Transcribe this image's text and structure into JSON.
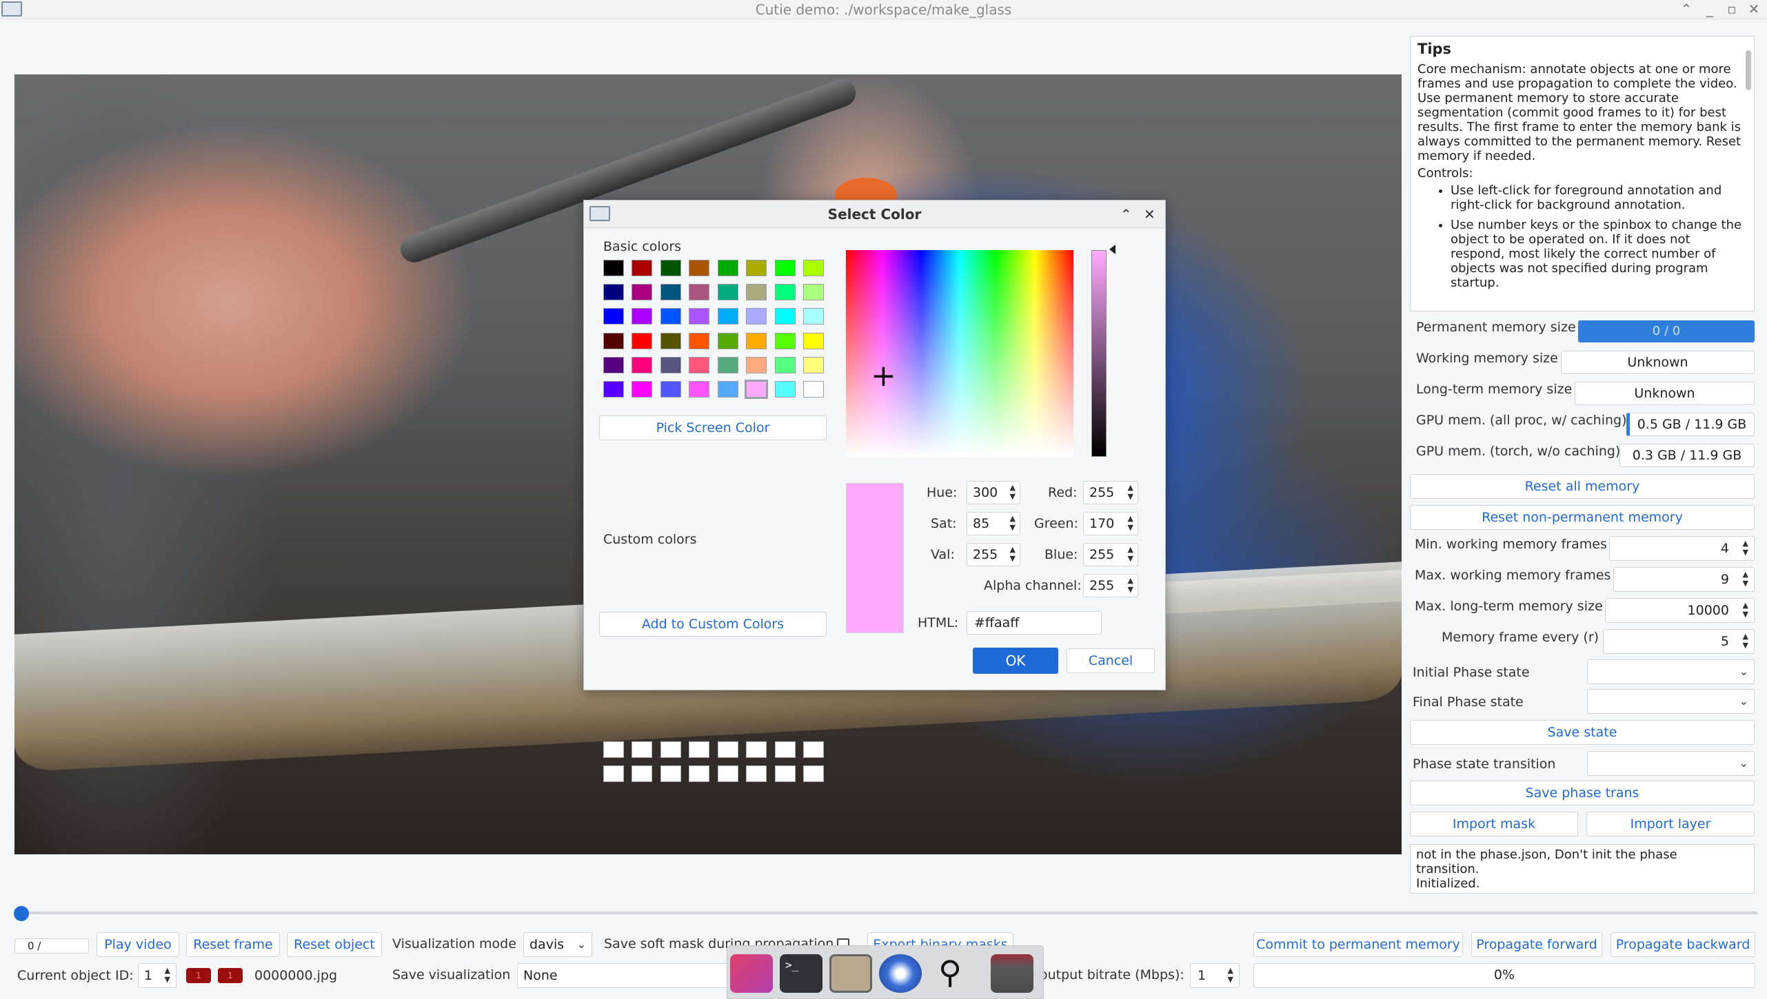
{
  "window": {
    "title": "Cutie demo: ./workspace/make_glass"
  },
  "tips": {
    "heading": "Tips",
    "intro": "Core mechanism: annotate objects at one or more frames and use propagation to complete the video. Use permanent memory to store accurate segmentation (commit good frames to it) for best results. The first frame to enter the memory bank is always committed to the permanent memory. Reset memory if needed.",
    "controls_heading": "Controls:",
    "bullets": [
      "Use left-click for foreground annotation and right-click for background annotation.",
      "Use number keys or the spinbox to change the object to be operated on. If it does not respond, most likely the correct number of objects was not specified during program startup."
    ]
  },
  "memory": {
    "permanent_label": "Permanent memory size",
    "permanent_value": "0 / 0",
    "working_label": "Working memory size",
    "working_value": "Unknown",
    "longterm_label": "Long-term memory size",
    "longterm_value": "Unknown",
    "gpu_all_label": "GPU mem. (all proc, w/ caching)",
    "gpu_all_value": "0.5 GB / 11.9 GB",
    "gpu_torch_label": "GPU mem. (torch, w/o caching)",
    "gpu_torch_value": "0.3 GB / 11.9 GB",
    "reset_all": "Reset all memory",
    "reset_nonperm": "Reset non-permanent memory",
    "min_work_label": "Min. working memory frames",
    "min_work_value": "4",
    "max_work_label": "Max. working memory frames",
    "max_work_value": "9",
    "max_lt_label": "Max. long-term memory size",
    "max_lt_value": "10000",
    "mem_every_label": "Memory frame every (r)",
    "mem_every_value": "5"
  },
  "phase": {
    "initial_label": "Initial Phase state",
    "final_label": "Final Phase state",
    "save_state": "Save state",
    "transition_label": "Phase state transition",
    "save_trans": "Save phase trans",
    "import_mask": "Import mask",
    "import_layer": "Import layer",
    "log_lines": [
      "not in the phase.json, Don't init the phase",
      "transition.",
      "Initialized."
    ]
  },
  "bottom": {
    "frame_counter": "0 /",
    "play_video": "Play video",
    "reset_frame": "Reset frame",
    "reset_object": "Reset object",
    "vis_mode_label": "Visualization mode",
    "vis_mode_value": "davis",
    "soft_mask_label": "Save soft mask during propagation",
    "export_binary": "Export binary masks",
    "commit": "Commit to permanent memory",
    "prop_forward": "Propagate forward",
    "prop_backward": "Propagate backward",
    "object_id_label": "Current object ID:",
    "object_id_value": "1",
    "badge_1": "1",
    "badge_2": "1",
    "filename": "0000000.jpg",
    "save_vis_label": "Save visualization",
    "save_vis_value": "None",
    "bitrate_label": "output bitrate (Mbps):",
    "bitrate_value": "1",
    "progress_text": "0%"
  },
  "dialog": {
    "title": "Select Color",
    "basic_colors_label": "Basic colors",
    "basic_colors": [
      [
        "#000000",
        "#aa0000",
        "#005500",
        "#aa5500",
        "#00aa00",
        "#aaaa00",
        "#00ff00",
        "#aaff00"
      ],
      [
        "#00007f",
        "#aa007f",
        "#00557f",
        "#aa557f",
        "#00aa7f",
        "#aaaa7f",
        "#00ff7f",
        "#aaff7f"
      ],
      [
        "#0000ff",
        "#aa00ff",
        "#0055ff",
        "#aa55ff",
        "#00aaff",
        "#aaaaff",
        "#00ffff",
        "#aaffff"
      ],
      [
        "#550000",
        "#ff0000",
        "#555500",
        "#ff5500",
        "#55aa00",
        "#ffaa00",
        "#55ff00",
        "#ffff00"
      ],
      [
        "#55007f",
        "#ff007f",
        "#55557f",
        "#ff557f",
        "#55aa7f",
        "#ffaa7f",
        "#55ff7f",
        "#ffff7f"
      ],
      [
        "#5500ff",
        "#ff00ff",
        "#5555ff",
        "#ff55ff",
        "#55aaff",
        "#ffaaff",
        "#55ffff",
        "#ffffff"
      ]
    ],
    "pick_screen": "Pick Screen Color",
    "custom_colors_label": "Custom colors",
    "add_custom": "Add to Custom Colors",
    "hue_label": "Hue:",
    "hue_value": "300",
    "sat_label": "Sat:",
    "sat_value": "85",
    "val_label": "Val:",
    "val_value": "255",
    "red_label": "Red:",
    "red_value": "255",
    "green_label": "Green:",
    "green_value": "170",
    "blue_label": "Blue:",
    "blue_value": "255",
    "alpha_label": "Alpha channel:",
    "alpha_value": "255",
    "html_label": "HTML:",
    "html_value": "#ffaaff",
    "ok": "OK",
    "cancel": "Cancel",
    "selected_color": "#ffaaff"
  }
}
